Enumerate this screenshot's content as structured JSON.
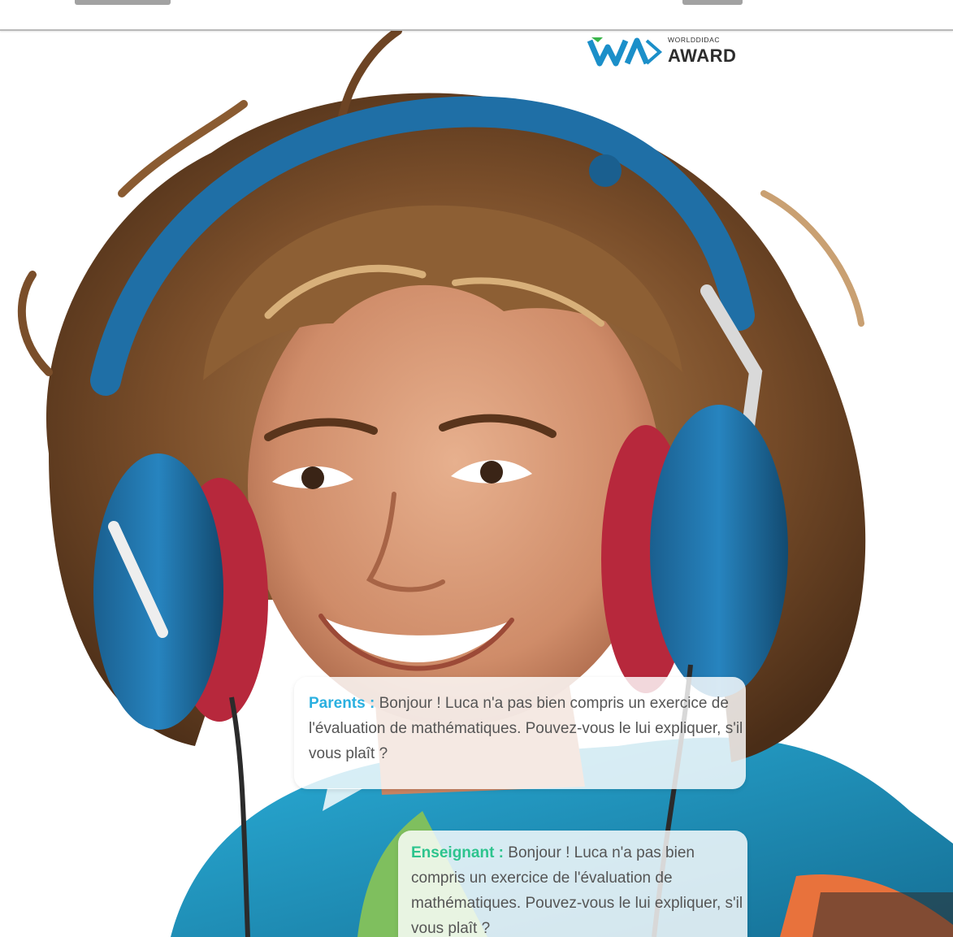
{
  "award": {
    "small_text": "WORLDDIDAC",
    "big_text": "AWARD",
    "mark": "WD"
  },
  "hero_image": {
    "icon": "smiling-child-with-headphones-photo"
  },
  "chat": [
    {
      "speaker": "Parents :",
      "message": "Bonjour ! Luca n'a pas bien compris un exercice de l'évaluation de mathématiques. Pouvez-vous le lui expliquer, s'il vous plaît ?",
      "color": "#2bb0e0"
    },
    {
      "speaker": "Enseignant :",
      "message": "Bonjour ! Luca n'a pas bien compris un exercice de l'évaluation de mathématiques. Pouvez-vous le lui expliquer, s'il vous plaît ?",
      "color": "#2dc48e"
    }
  ],
  "colors": {
    "headphone_blue": "#1f6fa6",
    "ear_pad_red": "#b7283c",
    "hoodie_teal": "#1d9cc7",
    "background": "#ffffff"
  }
}
